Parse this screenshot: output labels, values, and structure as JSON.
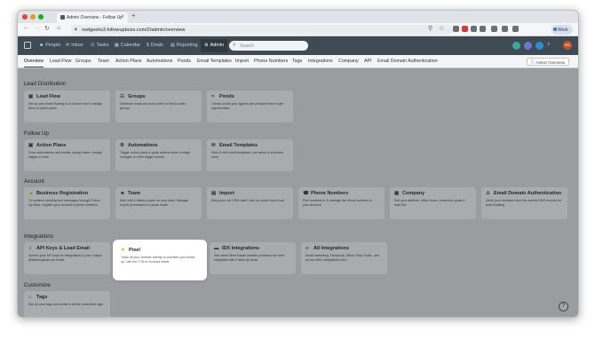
{
  "browser": {
    "tab_title": "Admin Overview - Follow Up",
    "url": "reelgeeks3.followupboss.com/2/admin/overview",
    "profile": "Work"
  },
  "app_nav": {
    "items": [
      "People",
      "Inbox",
      "Tasks",
      "Calendar",
      "Deals",
      "Reporting",
      "Admin"
    ],
    "active": "Admin",
    "search_placeholder": "Search",
    "avatar_initials": "RG"
  },
  "sub_tabs": {
    "items": [
      "Overview",
      "Lead Flow",
      "Groups",
      "Team",
      "Action Plans",
      "Automations",
      "Ponds",
      "Email Templates",
      "Import",
      "Phone Numbers",
      "Tags",
      "Integrations",
      "Company",
      "API",
      "Email Domain Authentication"
    ],
    "active": "Overview",
    "admin_overview_button": "Admin Overview"
  },
  "sections": {
    "lead_distribution": {
      "title": "Lead Distribution",
      "cards": [
        {
          "title": "Lead Flow",
          "icon": "lead-flow-icon",
          "desc": "Set up your leads flowing in & choose how to assign them & action plans"
        },
        {
          "title": "Groups",
          "icon": "groups-icon",
          "desc": "Distribute leads via round-robin or first-to-claim groups"
        },
        {
          "title": "Ponds",
          "icon": "ponds-icon",
          "desc": "Create ponds your agents can prospect from to get opportunities"
        }
      ]
    },
    "follow_up": {
      "title": "Follow Up",
      "cards": [
        {
          "title": "Action Plans",
          "icon": "action-plans-icon",
          "desc": "Drive automations and emails, assign tasks, change stages & more"
        },
        {
          "title": "Automations",
          "icon": "automations-icon",
          "desc": "Trigger action plans & quick actions when a stage changes or other trigger events"
        },
        {
          "title": "Email Templates",
          "icon": "email-templates-icon",
          "desc": "View & edit email templates, use specs & shortcuts rules"
        }
      ]
    },
    "account": {
      "title": "Account",
      "cards": [
        {
          "title": "Business Registration",
          "icon": "warning-icon",
          "desc": "To continue sending text messages through Follow Up Boss, register your account's phone numbers"
        },
        {
          "title": "Team",
          "icon": "team-icon",
          "desc": "Add, edit & delete people on your team. Manage export permissions & pause leads"
        },
        {
          "title": "Import",
          "icon": "import-icon",
          "desc": "Bring your old CRM data? Use our quick import tool"
        },
        {
          "title": "Phone Numbers",
          "icon": "phone-icon",
          "desc": "Port numbers in & manage the virtual numbers in your account"
        },
        {
          "title": "Company",
          "icon": "company-icon",
          "desc": "Edit your address, office hours, customize goals & lead IDs"
        },
        {
          "title": "Email Domain Authentication",
          "icon": "domain-auth-icon",
          "desc": "Verify your domains have the correct DNS records for bulk emailing"
        }
      ]
    },
    "integrations": {
      "title": "Integrations",
      "cards": [
        {
          "title": "API Keys & Lead Email",
          "icon": "key-icon",
          "desc": "Access your API keys for integrations & your unique @followupboss.me email"
        },
        {
          "title": "Pixel",
          "icon": "pixel-icon",
          "desc": "Track all your website activity to prioritize your follow up. Use the CTA to increase leads"
        },
        {
          "title": "IDX Integrations",
          "icon": "idx-icon",
          "desc": "See which Real Estate website providers are best integrated with Follow Up Boss"
        },
        {
          "title": "All Integrations",
          "icon": "link-icon",
          "desc": "Email marketing, Facebook, Zillow, Dirty Tricks - see all our other integrations here"
        }
      ]
    },
    "customize": {
      "title": "Customize",
      "cards": [
        {
          "title": "Tags",
          "icon": "tag-icon",
          "desc": "See all your tags and create & delete unneeded tags"
        }
      ]
    }
  },
  "help_label": "?"
}
